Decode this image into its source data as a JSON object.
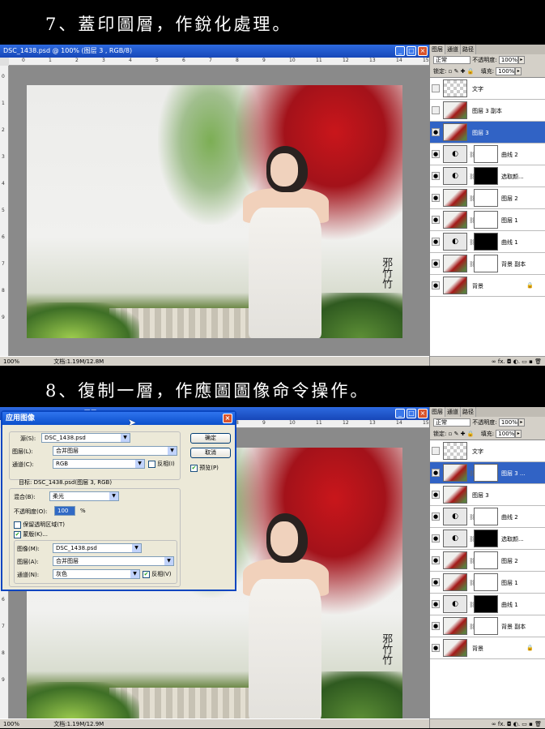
{
  "step7": {
    "heading": "7、蓋印圖層，作銳化處理。"
  },
  "step8": {
    "heading": "8、復制一層，作應圖圖像命令操作。"
  },
  "window": {
    "title": "DSC_1438.psd @ 100% (图层 3 , RGB/8)",
    "zoom": "100%",
    "status1": "文档:1.19M/12.8M",
    "status2": "文档:1.19M/12.9M",
    "ruler_marks": [
      "0",
      "1",
      "2",
      "3",
      "4",
      "5",
      "6",
      "7",
      "8",
      "9",
      "10",
      "11",
      "12",
      "13",
      "14",
      "15"
    ],
    "watermark": "邪竹竹"
  },
  "panel": {
    "tabs": [
      "图层",
      "通道",
      "路径"
    ],
    "blend_mode": "正常",
    "opacity_label": "不透明度:",
    "opacity_value": "100%",
    "lock_label": "锁定:",
    "fill_label": "填充:",
    "fill_value": "100%",
    "footer": "∞ fx. ◘ ◐. ▭ ▪ 🗑"
  },
  "layers1": [
    {
      "name": "文字",
      "thumb": "checker",
      "mask": "",
      "visible": false,
      "active": false
    },
    {
      "name": "图层 3 副本",
      "thumb": "pic",
      "mask": "",
      "visible": false,
      "active": false
    },
    {
      "name": "图层 3",
      "thumb": "pic",
      "mask": "",
      "visible": true,
      "active": true
    },
    {
      "name": "曲线 2",
      "thumb": "adj",
      "mask": "white",
      "visible": true,
      "active": false
    },
    {
      "name": "选取颜...",
      "thumb": "adj",
      "mask": "black",
      "visible": true,
      "active": false
    },
    {
      "name": "图层 2",
      "thumb": "pic",
      "mask": "white",
      "visible": true,
      "active": false
    },
    {
      "name": "图层 1",
      "thumb": "pic",
      "mask": "white",
      "visible": true,
      "active": false
    },
    {
      "name": "曲线 1",
      "thumb": "adj",
      "mask": "black",
      "visible": true,
      "active": false
    },
    {
      "name": "背景 副本",
      "thumb": "pic",
      "mask": "white",
      "visible": true,
      "active": false
    },
    {
      "name": "背景",
      "thumb": "pic",
      "mask": "",
      "visible": true,
      "active": false,
      "locked": true
    }
  ],
  "layers2": [
    {
      "name": "文字",
      "thumb": "checker",
      "mask": "",
      "visible": false,
      "active": false
    },
    {
      "name": "图层 3 ...",
      "thumb": "pic",
      "mask": "white",
      "visible": true,
      "active": true
    },
    {
      "name": "图层 3",
      "thumb": "pic",
      "mask": "",
      "visible": true,
      "active": false
    },
    {
      "name": "曲线 2",
      "thumb": "adj",
      "mask": "white",
      "visible": true,
      "active": false
    },
    {
      "name": "选取颜...",
      "thumb": "adj",
      "mask": "black",
      "visible": true,
      "active": false
    },
    {
      "name": "图层 2",
      "thumb": "pic",
      "mask": "white",
      "visible": true,
      "active": false
    },
    {
      "name": "图层 1",
      "thumb": "pic",
      "mask": "white",
      "visible": true,
      "active": false
    },
    {
      "name": "曲线 1",
      "thumb": "adj",
      "mask": "black",
      "visible": true,
      "active": false
    },
    {
      "name": "背景 副本",
      "thumb": "pic",
      "mask": "white",
      "visible": true,
      "active": false
    },
    {
      "name": "背景",
      "thumb": "pic",
      "mask": "",
      "visible": true,
      "active": false,
      "locked": true
    }
  ],
  "dialog": {
    "title": "应用图像",
    "source_label": "源(S):",
    "source_value": "DSC_1438.psd",
    "layer_label": "图层(L):",
    "layer_value": "合并图层",
    "channel_label": "通道(C):",
    "channel_value": "RGB",
    "invert_label": "反相(I)",
    "target_label": "目标:",
    "target_value": "DSC_1438.psd(图层 3, RGB)",
    "blending_label": "混合(B):",
    "blending_value": "柔光",
    "opacity_label": "不透明度(O):",
    "opacity_value": "100",
    "opacity_unit": "%",
    "preserve_label": "保留透明区域(T)",
    "mask_label": "蒙版(K)...",
    "mask_image_label": "图像(M):",
    "mask_image_value": "DSC_1438.psd",
    "mask_layer_label": "图层(A):",
    "mask_layer_value": "合并图层",
    "mask_channel_label": "通道(N):",
    "mask_channel_value": "灰色",
    "mask_invert_label": "反相(V)",
    "ok": "确定",
    "cancel": "取消",
    "preview_label": "预览(P)"
  }
}
